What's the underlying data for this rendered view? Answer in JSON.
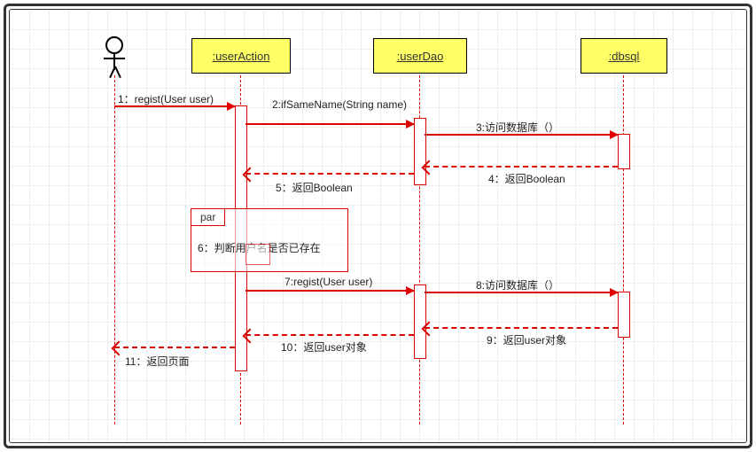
{
  "participants": {
    "userAction": ":userAction",
    "userDao": ":userDao",
    "dbsql": ":dbsql"
  },
  "fragment": {
    "kind": "par"
  },
  "messages": {
    "m1": "1：regist(User user)",
    "m2": "2:ifSameName(String name)",
    "m3": "3:访问数据库（）",
    "m4": "4：返回Boolean",
    "m5": "5：返回Boolean",
    "m6": "6：判断用户名是否已存在",
    "m7": "7:regist(User user)",
    "m8": "8:访问数据库（）",
    "m9": "9：返回user对象",
    "m10": "10：返回user对象",
    "m11": "11：返回页面"
  },
  "chart_data": {
    "type": "sequence-diagram",
    "actor": "User",
    "participants": [
      ":userAction",
      ":userDao",
      ":dbsql"
    ],
    "fragments": [
      {
        "type": "par",
        "covers": [
          "m6"
        ]
      }
    ],
    "messages": [
      {
        "id": "m1",
        "from": "User",
        "to": ":userAction",
        "label": "1：regist(User user)",
        "kind": "sync"
      },
      {
        "id": "m2",
        "from": ":userAction",
        "to": ":userDao",
        "label": "2:ifSameName(String name)",
        "kind": "sync"
      },
      {
        "id": "m3",
        "from": ":userDao",
        "to": ":dbsql",
        "label": "3:访问数据库（）",
        "kind": "sync"
      },
      {
        "id": "m4",
        "from": ":dbsql",
        "to": ":userDao",
        "label": "4：返回Boolean",
        "kind": "return"
      },
      {
        "id": "m5",
        "from": ":userDao",
        "to": ":userAction",
        "label": "5：返回Boolean",
        "kind": "return"
      },
      {
        "id": "m6",
        "from": ":userAction",
        "to": ":userAction",
        "label": "6：判断用户名是否已存在",
        "kind": "self"
      },
      {
        "id": "m7",
        "from": ":userAction",
        "to": ":userDao",
        "label": "7:regist(User user)",
        "kind": "sync"
      },
      {
        "id": "m8",
        "from": ":userDao",
        "to": ":dbsql",
        "label": "8:访问数据库（）",
        "kind": "sync"
      },
      {
        "id": "m9",
        "from": ":dbsql",
        "to": ":userDao",
        "label": "9：返回user对象",
        "kind": "return"
      },
      {
        "id": "m10",
        "from": ":userDao",
        "to": ":userAction",
        "label": "10：返回user对象",
        "kind": "return"
      },
      {
        "id": "m11",
        "from": ":userAction",
        "to": "User",
        "label": "11：返回页面",
        "kind": "return"
      }
    ]
  }
}
